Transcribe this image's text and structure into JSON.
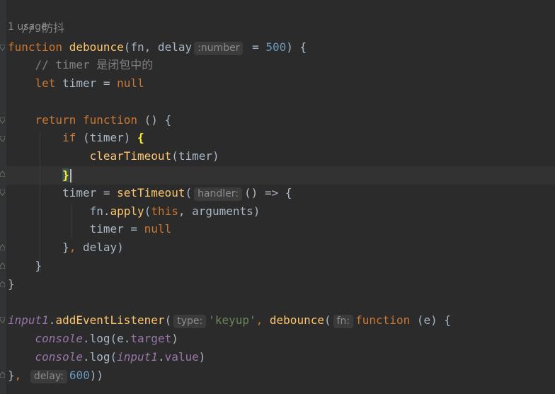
{
  "editor": {
    "comment_top": "// 防抖",
    "usage": "1 usage",
    "l_function_kw": "function",
    "l_debounce_name": "debounce",
    "l_params_a": "(fn, delay",
    "hint_number": ":number",
    "l_params_eq": " = ",
    "default_delay": "500",
    "l_params_end": ") {",
    "comment_timer": "// timer 是闭包中的",
    "let_kw": "let",
    "timer_decl": " timer = ",
    "null1": "null",
    "return_kw": "return",
    "return_fn_kw": "function",
    "return_rest": " () {",
    "if_kw": "if",
    "if_cond": " (timer) ",
    "if_open_brace": "{",
    "clear_fn": "clearTimeout",
    "clear_args": "(timer)",
    "if_close_brace": "}",
    "timer_assign": "timer = ",
    "settimeout_fn": "setTimeout",
    "paren_open": "(",
    "hint_handler": "handler:",
    "arrow": "() => {",
    "fn_obj": "fn.",
    "apply_fn": "apply",
    "apply_open": "(",
    "this_kw": "this",
    "apply_rest": ", arguments)",
    "timer_reset": "timer = ",
    "null2": "null",
    "close_settimeout_a": "}",
    "close_settimeout_comma": ",",
    "close_settimeout_b": " delay)",
    "close_return": "}",
    "close_func": "}",
    "input1_a": "input1",
    "dot1": ".",
    "add_listener_fn": "addEventListener",
    "paren2": "(",
    "hint_type": "type:",
    "keyup_str": "'keyup'",
    "comma1": ", ",
    "debounce_call": "debounce",
    "paren3": "(",
    "hint_fn": "fn:",
    "function_kw2": "function",
    "e_param": " (e) {",
    "console1": "console",
    "log1": ".log(e.",
    "target_prop": "target",
    "log1_end": ")",
    "console2": "console",
    "log2": ".log(",
    "input1_b": "input1",
    "dot2": ".",
    "value_prop": "value",
    "log2_end": ")",
    "close_last_a": "}",
    "close_last_comma": ",",
    "hint_delay": "delay:",
    "delay_600": "600",
    "close_last_end": "))"
  },
  "colors": {
    "background": "#2b2b2b",
    "keyword": "#cc7832",
    "function_name": "#ffc66d",
    "number": "#6897bb",
    "string": "#6a8759",
    "global_var": "#9876aa",
    "comment": "#808080",
    "plain": "#a9b7c6",
    "brace_match": "#ffef28"
  }
}
